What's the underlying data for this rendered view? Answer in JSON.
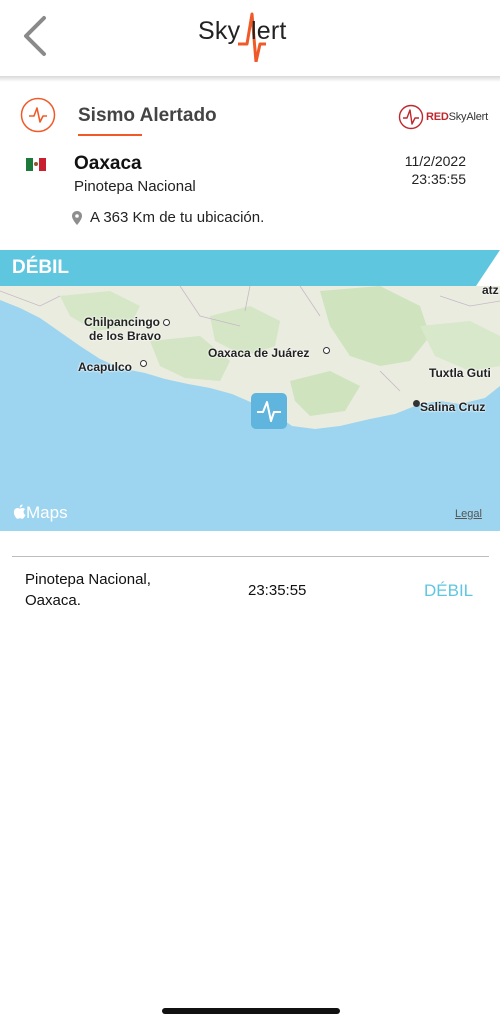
{
  "header": {
    "logo_left": "Sky",
    "logo_right": "lert",
    "logo_accent_letter": "A",
    "brand_color": "#f05a28"
  },
  "alert": {
    "title": "Sismo Alertado",
    "partner_logo_red": "RED",
    "partner_logo_rest": "SkyAlert"
  },
  "event": {
    "state": "Oaxaca",
    "city": "Pinotepa Nacional",
    "date": "11/2/2022",
    "time": "23:35:55",
    "distance": "A 363 Km de tu ubicación.",
    "flag": "mexico-flag-icon"
  },
  "intensity": {
    "label": "DÉBIL",
    "color": "#5fc6e0"
  },
  "map": {
    "labels": {
      "chilpancingo_1": "Chilpancingo",
      "chilpancingo_2": "de los Bravo",
      "acapulco": "Acapulco",
      "oaxaca": "Oaxaca de Juárez",
      "tuxtla": "Tuxtla Guti",
      "salina_cruz": "Salina Cruz",
      "edge_top": "atz"
    },
    "brand": "Maps",
    "legal": "Legal"
  },
  "detail_row": {
    "location_line1": "Pinotepa Nacional,",
    "location_line2": "Oaxaca.",
    "time": "23:35:55",
    "level": "DÉBIL"
  }
}
